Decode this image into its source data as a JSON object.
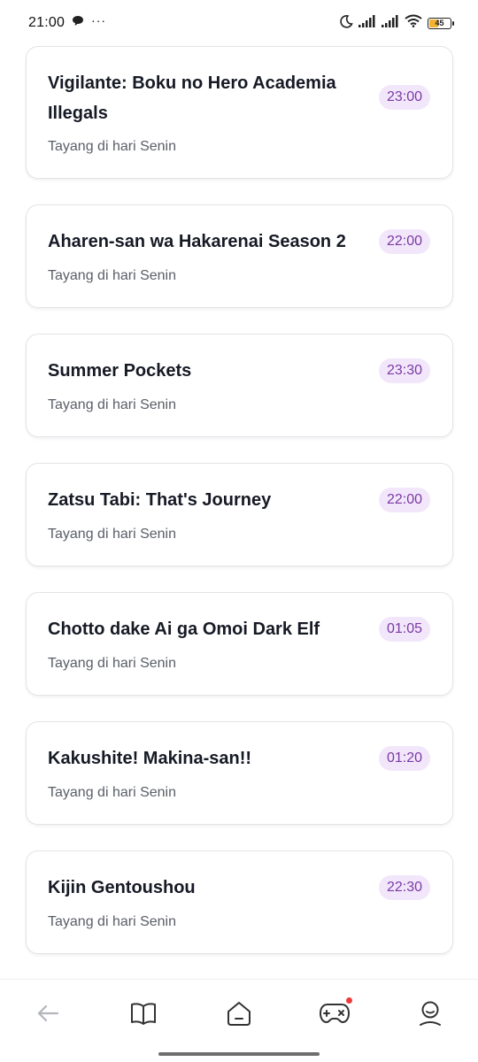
{
  "status_bar": {
    "time": "21:00",
    "dots": "···",
    "battery": "45",
    "battery_level": 0.45,
    "icons": [
      "chat-bubble-icon",
      "moon-icon",
      "signal-icon",
      "signal-icon",
      "wifi-icon",
      "battery-icon"
    ]
  },
  "schedule": {
    "items": [
      {
        "title": "Vigilante: Boku no Hero Academia Illegals",
        "subtitle": "Tayang di hari Senin",
        "time": "23:00"
      },
      {
        "title": "Aharen-san wa Hakarenai Season 2",
        "subtitle": "Tayang di hari Senin",
        "time": "22:00"
      },
      {
        "title": "Summer Pockets",
        "subtitle": "Tayang di hari Senin",
        "time": "23:30"
      },
      {
        "title": "Zatsu Tabi: That's Journey",
        "subtitle": "Tayang di hari Senin",
        "time": "22:00"
      },
      {
        "title": "Chotto dake Ai ga Omoi Dark Elf",
        "subtitle": "Tayang di hari Senin",
        "time": "01:05"
      },
      {
        "title": "Kakushite! Makina-san!!",
        "subtitle": "Tayang di hari Senin",
        "time": "01:20"
      },
      {
        "title": "Kijin Gentoushou",
        "subtitle": "Tayang di hari Senin",
        "time": "22:30"
      }
    ]
  },
  "bottom_nav": {
    "items": [
      {
        "icon": "back-arrow-icon"
      },
      {
        "icon": "book-icon"
      },
      {
        "icon": "home-icon"
      },
      {
        "icon": "gamepad-icon"
      },
      {
        "icon": "profile-icon"
      }
    ]
  },
  "colors": {
    "accent": "#7a3aa4",
    "badge_bg": "#f2e6fb",
    "notification": "#ef3a3a"
  }
}
